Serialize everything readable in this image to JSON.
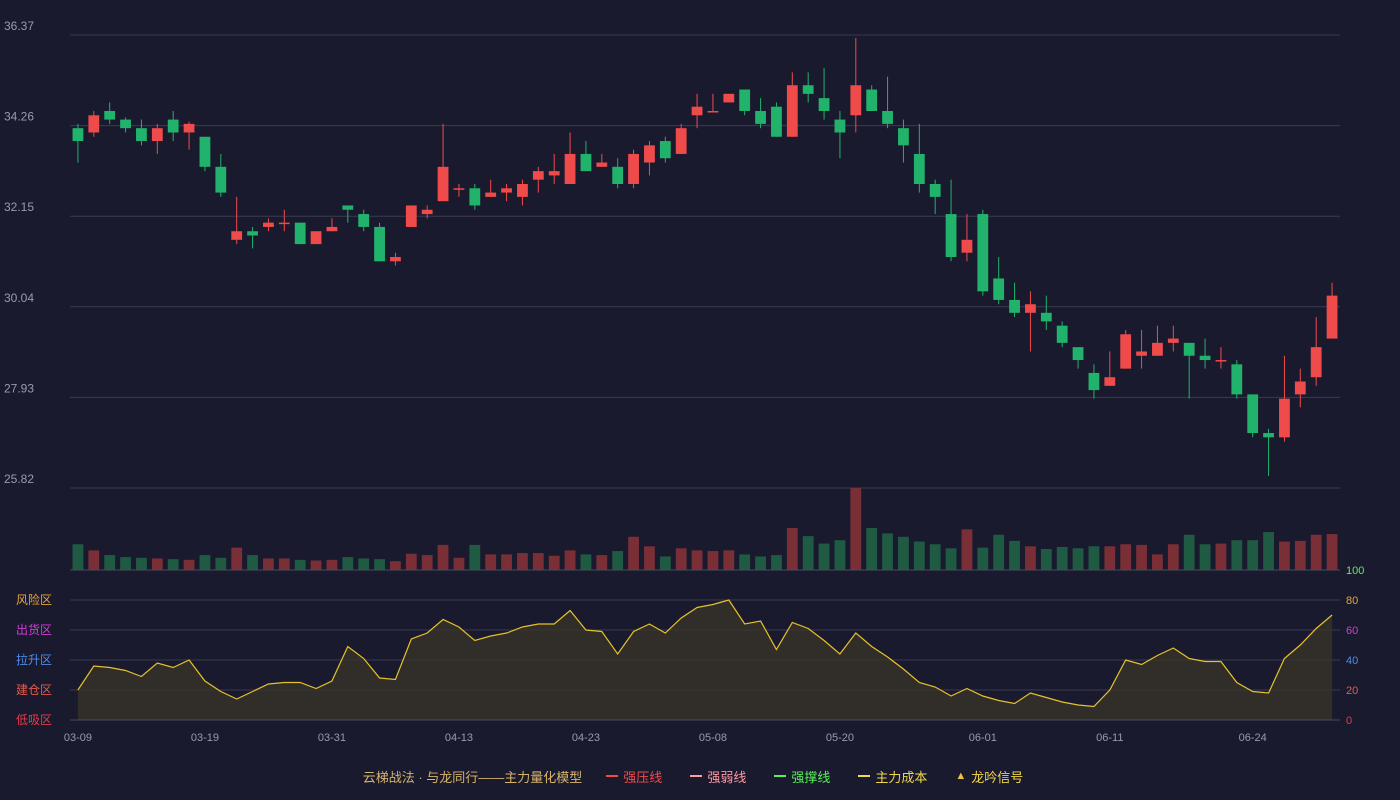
{
  "chart_data": {
    "type": "candlestick",
    "dates": [
      "03-09",
      "03-10",
      "03-11",
      "03-12",
      "03-13",
      "03-16",
      "03-17",
      "03-18",
      "03-19",
      "03-20",
      "03-23",
      "03-24",
      "03-25",
      "03-26",
      "03-27",
      "03-30",
      "03-31",
      "04-01",
      "04-02",
      "04-03",
      "04-07",
      "04-08",
      "04-09",
      "04-10",
      "04-13",
      "04-14",
      "04-15",
      "04-16",
      "04-17",
      "04-20",
      "04-21",
      "04-22",
      "04-23",
      "04-24",
      "04-27",
      "04-28",
      "04-29",
      "04-30",
      "05-06",
      "05-07",
      "05-08",
      "05-09",
      "05-12",
      "05-13",
      "05-14",
      "05-15",
      "05-16",
      "05-19",
      "05-20",
      "05-21",
      "05-22",
      "05-23",
      "05-26",
      "05-27",
      "05-28",
      "05-29",
      "05-30",
      "06-01",
      "06-02",
      "06-03",
      "06-04",
      "06-05",
      "06-06",
      "06-09",
      "06-10",
      "06-11",
      "06-12",
      "06-13",
      "06-16",
      "06-17",
      "06-18",
      "06-19",
      "06-20",
      "06-23",
      "06-24",
      "06-25",
      "06-26",
      "06-27",
      "06-30",
      "07-01",
      "07-02"
    ],
    "ohlc": [
      [
        34.2,
        33.9,
        34.3,
        33.4
      ],
      [
        34.1,
        34.5,
        34.6,
        34.0
      ],
      [
        34.6,
        34.4,
        34.8,
        34.3
      ],
      [
        34.4,
        34.2,
        34.45,
        34.1
      ],
      [
        34.2,
        33.9,
        34.4,
        33.8
      ],
      [
        33.9,
        34.2,
        34.3,
        33.6
      ],
      [
        34.4,
        34.1,
        34.6,
        33.9
      ],
      [
        34.1,
        34.3,
        34.35,
        33.7
      ],
      [
        34.0,
        33.3,
        34.0,
        33.2
      ],
      [
        33.3,
        32.7,
        33.6,
        32.6
      ],
      [
        31.6,
        31.8,
        32.6,
        31.5
      ],
      [
        31.8,
        31.7,
        31.9,
        31.4
      ],
      [
        31.9,
        32.0,
        32.1,
        31.8
      ],
      [
        32.0,
        32.0,
        32.3,
        31.8
      ],
      [
        32.0,
        31.5,
        32.0,
        31.5
      ],
      [
        31.5,
        31.8,
        31.8,
        31.5
      ],
      [
        31.8,
        31.9,
        32.1,
        31.8
      ],
      [
        32.4,
        32.3,
        32.4,
        32.0
      ],
      [
        32.2,
        31.9,
        32.3,
        31.8
      ],
      [
        31.9,
        31.1,
        32.0,
        31.1
      ],
      [
        31.1,
        31.2,
        31.3,
        31.0
      ],
      [
        31.9,
        32.4,
        32.4,
        31.9
      ],
      [
        32.2,
        32.3,
        32.4,
        32.1
      ],
      [
        32.5,
        33.3,
        34.3,
        32.5
      ],
      [
        32.8,
        32.8,
        32.9,
        32.6
      ],
      [
        32.8,
        32.4,
        32.9,
        32.3
      ],
      [
        32.6,
        32.7,
        33.0,
        32.6
      ],
      [
        32.7,
        32.8,
        32.9,
        32.5
      ],
      [
        32.6,
        32.9,
        33.0,
        32.4
      ],
      [
        33.0,
        33.2,
        33.3,
        32.7
      ],
      [
        33.1,
        33.2,
        33.6,
        32.9
      ],
      [
        32.9,
        33.6,
        34.1,
        32.9
      ],
      [
        33.6,
        33.2,
        33.9,
        33.2
      ],
      [
        33.3,
        33.4,
        33.6,
        33.3
      ],
      [
        33.3,
        32.9,
        33.5,
        32.8
      ],
      [
        32.9,
        33.6,
        33.7,
        32.8
      ],
      [
        33.4,
        33.8,
        33.9,
        33.1
      ],
      [
        33.9,
        33.5,
        34.0,
        33.4
      ],
      [
        33.6,
        34.2,
        34.3,
        33.6
      ],
      [
        34.5,
        34.7,
        35.0,
        34.2
      ],
      [
        34.6,
        34.6,
        35.0,
        34.6
      ],
      [
        34.8,
        35.0,
        35.0,
        34.8
      ],
      [
        35.1,
        34.6,
        35.1,
        34.5
      ],
      [
        34.6,
        34.3,
        34.9,
        34.2
      ],
      [
        34.7,
        34.0,
        34.8,
        34.0
      ],
      [
        34.0,
        35.2,
        35.5,
        34.0
      ],
      [
        35.2,
        35.0,
        35.5,
        34.8
      ],
      [
        34.9,
        34.6,
        35.6,
        34.4
      ],
      [
        34.4,
        34.1,
        34.6,
        33.5
      ],
      [
        34.5,
        35.2,
        36.3,
        34.1
      ],
      [
        35.1,
        34.6,
        35.2,
        34.6
      ],
      [
        34.6,
        34.3,
        35.4,
        34.2
      ],
      [
        34.2,
        33.8,
        34.4,
        33.4
      ],
      [
        33.6,
        32.9,
        34.3,
        32.7
      ],
      [
        32.9,
        32.6,
        33.0,
        32.2
      ],
      [
        32.2,
        31.2,
        33.0,
        31.1
      ],
      [
        31.3,
        31.6,
        32.2,
        31.1
      ],
      [
        32.2,
        30.4,
        32.3,
        30.3
      ],
      [
        30.7,
        30.2,
        31.2,
        30.1
      ],
      [
        30.2,
        29.9,
        30.6,
        29.8
      ],
      [
        29.9,
        30.1,
        30.4,
        29.0
      ],
      [
        29.9,
        29.7,
        30.3,
        29.5
      ],
      [
        29.6,
        29.2,
        29.7,
        29.1
      ],
      [
        29.1,
        28.8,
        29.1,
        28.6
      ],
      [
        28.5,
        28.1,
        28.7,
        27.9
      ],
      [
        28.2,
        28.4,
        29.0,
        28.2
      ],
      [
        28.6,
        29.4,
        29.5,
        28.6
      ],
      [
        28.9,
        29.0,
        29.5,
        28.6
      ],
      [
        28.9,
        29.2,
        29.6,
        28.9
      ],
      [
        29.2,
        29.3,
        29.6,
        29.0
      ],
      [
        29.2,
        28.9,
        29.2,
        27.9
      ],
      [
        28.9,
        28.8,
        29.3,
        28.6
      ],
      [
        28.8,
        28.8,
        29.1,
        28.6
      ],
      [
        28.7,
        28.0,
        28.8,
        27.9
      ],
      [
        28.0,
        27.1,
        28.0,
        27.0
      ],
      [
        27.1,
        27.0,
        27.2,
        26.1
      ],
      [
        27.0,
        27.9,
        28.9,
        26.9
      ],
      [
        28.0,
        28.3,
        28.6,
        27.7
      ],
      [
        28.4,
        29.1,
        29.8,
        28.2
      ],
      [
        29.3,
        30.3,
        30.6,
        29.3
      ]
    ],
    "volume": [
      38,
      29,
      22,
      19,
      18,
      17,
      16,
      15,
      22,
      18,
      33,
      22,
      17,
      17,
      15,
      14,
      15,
      19,
      17,
      16,
      13,
      24,
      22,
      37,
      18,
      37,
      23,
      23,
      25,
      25,
      21,
      29,
      23,
      22,
      28,
      49,
      35,
      20,
      32,
      29,
      28,
      29,
      23,
      20,
      22,
      62,
      50,
      39,
      44,
      121,
      62,
      54,
      49,
      42,
      38,
      32,
      60,
      33,
      52,
      43,
      35,
      31,
      34,
      32,
      35,
      35,
      38,
      37,
      23,
      38,
      52,
      38,
      39,
      44,
      44,
      56,
      42,
      43,
      52,
      53
    ],
    "indicator": [
      20,
      36,
      35,
      33,
      29,
      38,
      35,
      40,
      26,
      19,
      14,
      19,
      24,
      25,
      25,
      21,
      26,
      49,
      41,
      28,
      27,
      54,
      58,
      67,
      62,
      53,
      56,
      58,
      62,
      64,
      64,
      73,
      60,
      59,
      44,
      59,
      64,
      58,
      68,
      75,
      77,
      80,
      64,
      66,
      47,
      65,
      61,
      53,
      44,
      58,
      49,
      42,
      34,
      25,
      22,
      16,
      21,
      16,
      13,
      11,
      18,
      15,
      12,
      10,
      9,
      20,
      40,
      37,
      43,
      48,
      41,
      39,
      39,
      25,
      19,
      18,
      41,
      50,
      61,
      70
    ]
  },
  "price_axis": {
    "ticks": [
      "36.37",
      "34.26",
      "32.15",
      "30.04",
      "27.93",
      "25.82"
    ]
  },
  "indicator_axis": {
    "ticks": [
      "100",
      "80",
      "60",
      "40",
      "20",
      "0"
    ]
  },
  "zones": [
    {
      "label": "风险区",
      "color": "#e8a23a"
    },
    {
      "label": "出货区",
      "color": "#d63bd6"
    },
    {
      "label": "拉升区",
      "color": "#4c8de8"
    },
    {
      "label": "建仓区",
      "color": "#e85a4a"
    },
    {
      "label": "低吸区",
      "color": "#e83a4a"
    }
  ],
  "x_labels": [
    "03-09",
    "03-19",
    "03-31",
    "04-13",
    "04-23",
    "05-08",
    "05-20",
    "06-01",
    "06-11",
    "06-24"
  ],
  "legend": {
    "title": "云梯战法 · 与龙同行——主力量化模型",
    "items": [
      {
        "label": "强压线",
        "color": "#ef4b4b",
        "style": "solid"
      },
      {
        "label": "强弱线",
        "color": "#ff9aa0",
        "style": "dashed"
      },
      {
        "label": "强撑线",
        "color": "#58f058",
        "style": "solid"
      },
      {
        "label": "主力成本",
        "color": "#f0d84a",
        "style": "dashed"
      },
      {
        "label": "龙吟信号",
        "color": "#f0c040",
        "style": "triangle"
      }
    ]
  },
  "colors": {
    "up": "#ef4b4b",
    "down": "#21b36b",
    "grid": "#3a3b50",
    "axis_text": "#9a9aaa",
    "line": "#e6c229"
  }
}
